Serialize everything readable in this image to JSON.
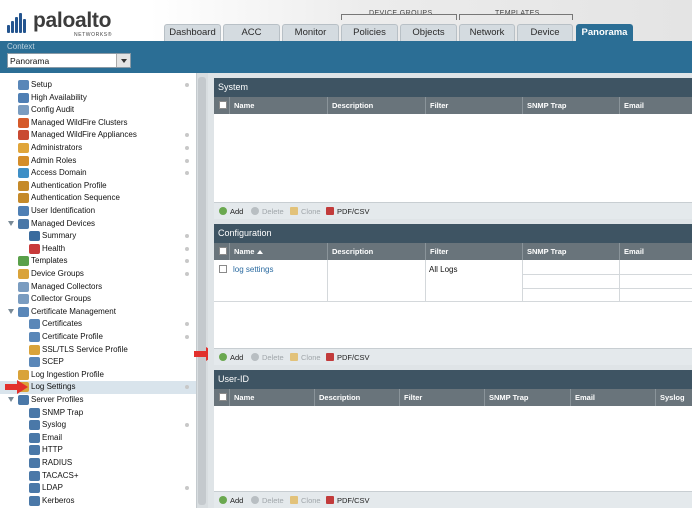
{
  "app": {
    "logo_word": "paloalto",
    "logo_sub": "NETWORKS®"
  },
  "tabs": [
    {
      "label": "Dashboard"
    },
    {
      "label": "ACC"
    },
    {
      "label": "Monitor"
    },
    {
      "label": "Policies"
    },
    {
      "label": "Objects"
    },
    {
      "label": "Network"
    },
    {
      "label": "Device"
    },
    {
      "label": "Panorama",
      "active": true
    }
  ],
  "tab_groups": {
    "device_groups": "DEVICE GROUPS",
    "templates": "TEMPLATES"
  },
  "context": {
    "label": "Context",
    "value": "Panorama"
  },
  "sidebar": {
    "items": [
      {
        "label": "Setup",
        "icon": "setup-icon",
        "color": "#5a87b8",
        "dot": true
      },
      {
        "label": "High Availability",
        "icon": "ha-icon",
        "color": "#4f7fb4",
        "dot": false
      },
      {
        "label": "Config Audit",
        "icon": "audit-icon",
        "color": "#7a9cc0",
        "dot": false
      },
      {
        "label": "Managed WildFire Clusters",
        "icon": "wildfire-clusters-icon",
        "color": "#d55a2a",
        "dot": false
      },
      {
        "label": "Managed WildFire Appliances",
        "icon": "wildfire-appliances-icon",
        "color": "#c94a32",
        "dot": true
      },
      {
        "label": "Administrators",
        "icon": "admin-icon",
        "color": "#e0a53a",
        "dot": true
      },
      {
        "label": "Admin Roles",
        "icon": "admin-roles-icon",
        "color": "#d48d2a",
        "dot": true
      },
      {
        "label": "Access Domain",
        "icon": "access-domain-icon",
        "color": "#3e8fc6",
        "dot": true
      },
      {
        "label": "Authentication Profile",
        "icon": "auth-profile-icon",
        "color": "#c58a2a",
        "dot": false
      },
      {
        "label": "Authentication Sequence",
        "icon": "auth-sequence-icon",
        "color": "#c58a2a",
        "dot": false
      },
      {
        "label": "User Identification",
        "icon": "user-id-icon",
        "color": "#4f7fb4",
        "dot": false
      },
      {
        "label": "Managed Devices",
        "icon": "managed-devices-icon",
        "color": "#4a78a8",
        "dot": false,
        "expanded": true
      },
      {
        "label": "Summary",
        "icon": "summary-icon",
        "color": "#3a6c9e",
        "dot": true,
        "indent": 1
      },
      {
        "label": "Health",
        "icon": "health-icon",
        "color": "#c83a3a",
        "dot": true,
        "indent": 1
      },
      {
        "label": "Templates",
        "icon": "templates-icon",
        "color": "#5aa04a",
        "dot": true
      },
      {
        "label": "Device Groups",
        "icon": "device-groups-icon",
        "color": "#d9a33a",
        "dot": true
      },
      {
        "label": "Managed Collectors",
        "icon": "managed-collectors-icon",
        "color": "#7a9cc0",
        "dot": false
      },
      {
        "label": "Collector Groups",
        "icon": "collector-groups-icon",
        "color": "#7a9cc0",
        "dot": false
      },
      {
        "label": "Certificate Management",
        "icon": "certificate-management-icon",
        "color": "#5a87b8",
        "dot": false,
        "expanded": true
      },
      {
        "label": "Certificates",
        "icon": "certificates-icon",
        "color": "#5a87b8",
        "dot": true,
        "indent": 1
      },
      {
        "label": "Certificate Profile",
        "icon": "certificate-profile-icon",
        "color": "#5a87b8",
        "dot": true,
        "indent": 1
      },
      {
        "label": "SSL/TLS Service Profile",
        "icon": "ssl-tls-profile-icon",
        "color": "#d9a33a",
        "dot": false,
        "indent": 1
      },
      {
        "label": "SCEP",
        "icon": "scep-icon",
        "color": "#5a87b8",
        "dot": false,
        "indent": 1
      },
      {
        "label": "Log Ingestion Profile",
        "icon": "log-ingestion-icon",
        "color": "#d9a33a",
        "dot": false
      },
      {
        "label": "Log Settings",
        "icon": "log-settings-icon",
        "color": "#d9a33a",
        "dot": true,
        "selected": true
      },
      {
        "label": "Server Profiles",
        "icon": "server-profiles-icon",
        "color": "#4a78a8",
        "dot": false,
        "expanded": true
      },
      {
        "label": "SNMP Trap",
        "icon": "snmp-trap-icon",
        "color": "#4a78a8",
        "dot": false,
        "indent": 1
      },
      {
        "label": "Syslog",
        "icon": "syslog-icon",
        "color": "#4a78a8",
        "dot": true,
        "indent": 1
      },
      {
        "label": "Email",
        "icon": "email-icon",
        "color": "#4a78a8",
        "dot": false,
        "indent": 1
      },
      {
        "label": "HTTP",
        "icon": "http-icon",
        "color": "#4a78a8",
        "dot": false,
        "indent": 1
      },
      {
        "label": "RADIUS",
        "icon": "radius-icon",
        "color": "#4a78a8",
        "dot": false,
        "indent": 1
      },
      {
        "label": "TACACS+",
        "icon": "tacacs-icon",
        "color": "#4a78a8",
        "dot": false,
        "indent": 1
      },
      {
        "label": "LDAP",
        "icon": "ldap-icon",
        "color": "#4a78a8",
        "dot": true,
        "indent": 1
      },
      {
        "label": "Kerberos",
        "icon": "kerberos-icon",
        "color": "#4a78a8",
        "dot": false,
        "indent": 1
      }
    ]
  },
  "panels": {
    "system": {
      "title": "System",
      "columns": [
        "Name",
        "Description",
        "Filter",
        "SNMP Trap",
        "Email"
      ]
    },
    "configuration": {
      "title": "Configuration",
      "columns": [
        "Name",
        "Description",
        "Filter",
        "SNMP Trap",
        "Email"
      ],
      "rows": [
        {
          "name": "log settings",
          "description": "",
          "filter": "All Logs"
        }
      ]
    },
    "userid": {
      "title": "User-ID",
      "columns": [
        "Name",
        "Description",
        "Filter",
        "SNMP Trap",
        "Email",
        "Syslog"
      ]
    }
  },
  "footer": {
    "add": "Add",
    "delete": "Delete",
    "clone": "Clone",
    "pdfcsv": "PDF/CSV"
  },
  "colors": {
    "brand_blue": "#2b6e95",
    "panel_title": "#3e5463",
    "table_header": "#69747b",
    "arrow": "#e2302c"
  }
}
